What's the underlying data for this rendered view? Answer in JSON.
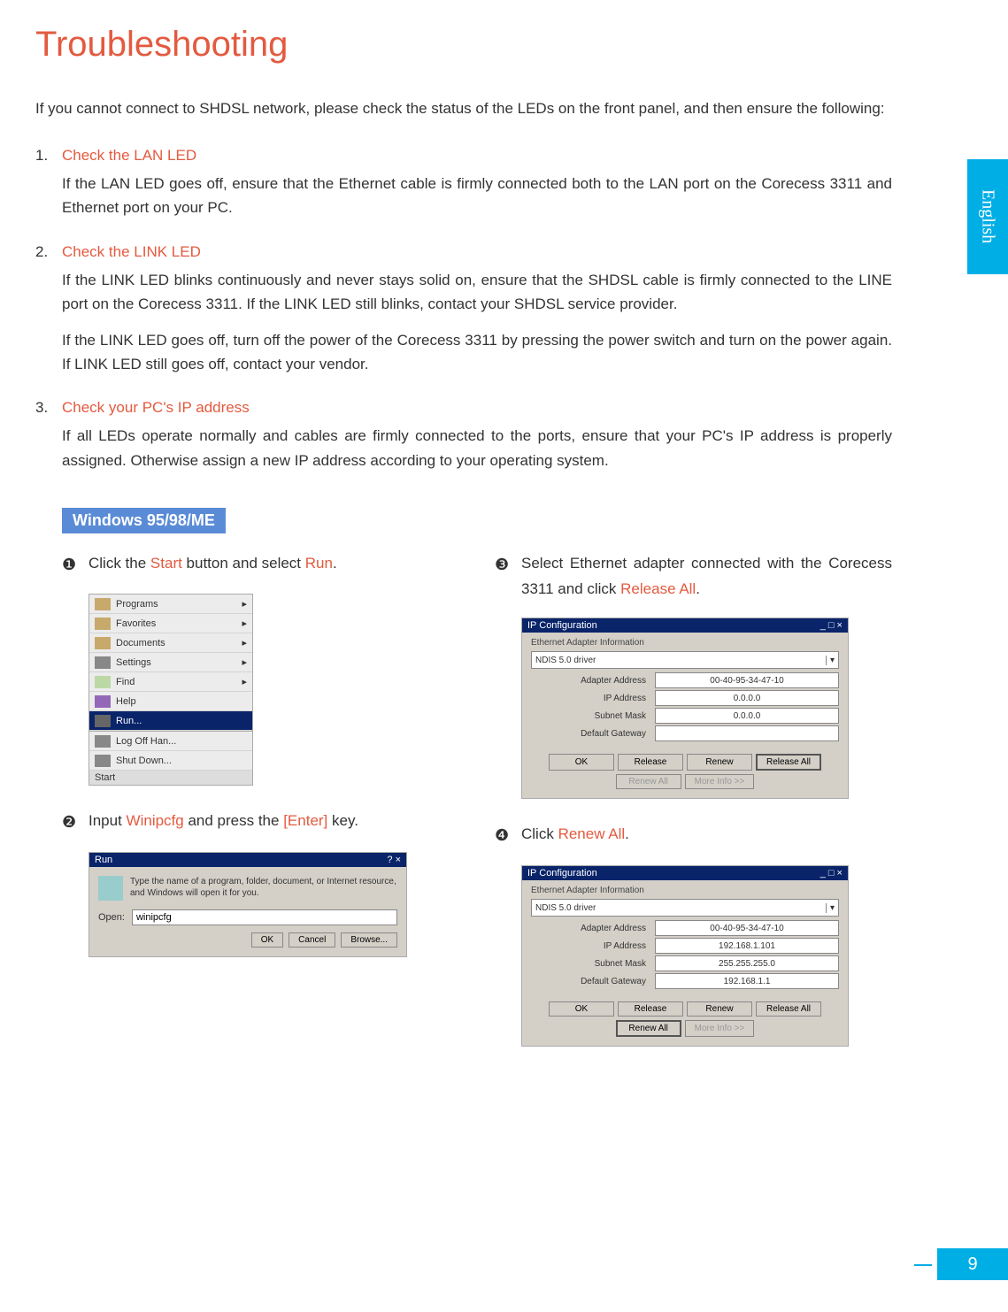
{
  "page": {
    "title": "Troubleshooting",
    "intro": "If you cannot connect to SHDSL network, please check the status of the LEDs on the front panel, and then ensure the following:",
    "side_tab": "English",
    "page_number": "9"
  },
  "steps": [
    {
      "title": "Check the LAN LED",
      "paras": [
        "If the LAN LED goes off, ensure that the Ethernet cable is firmly connected both to the LAN port on the Corecess 3311 and Ethernet port on your PC."
      ]
    },
    {
      "title": "Check the LINK LED",
      "paras": [
        "If the LINK LED blinks continuously and never stays solid on, ensure that the SHDSL cable is firmly connected to the LINE port on the Corecess 3311. If the LINK LED still blinks, contact your SHDSL service provider.",
        "If the LINK LED goes off, turn off the power of the Corecess 3311 by pressing the power switch and turn on the power again. If LINK LED still goes off, contact your vendor."
      ]
    },
    {
      "title": "Check your PC's IP address",
      "paras": [
        "If all LEDs operate normally and cables are firmly connected to the ports, ensure that your PC's IP address is properly assigned. Otherwise assign a new IP address according to your operating system."
      ]
    }
  ],
  "os_tag": "Windows 95/98/ME",
  "sub": {
    "b1": {
      "bullet": "❶",
      "pre": "Click the ",
      "orange1": "Start",
      "mid": " button and select ",
      "orange2": "Run",
      "post": "."
    },
    "b2": {
      "bullet": "❷",
      "pre": "Input ",
      "orange1": "Winipcfg",
      "mid": " and press the ",
      "orange2": "[Enter]",
      "post": " key."
    },
    "b3": {
      "bullet": "❸",
      "pre": "Select Ethernet adapter connected with the Corecess 3311 and click ",
      "orange1": "Release All",
      "post": "."
    },
    "b4": {
      "bullet": "❹",
      "pre": "Click ",
      "orange1": "Renew All",
      "post": "."
    }
  },
  "startmenu": {
    "items": [
      "Programs",
      "Favorites",
      "Documents",
      "Settings",
      "Find",
      "Help",
      "Run..."
    ],
    "lower": [
      "Log Off Han...",
      "Shut Down..."
    ],
    "start": "Start"
  },
  "rundlg": {
    "title": "Run",
    "msg": "Type the name of a program, folder, document, or Internet resource, and Windows will open it for you.",
    "open_label": "Open:",
    "open_value": "winipcfg",
    "btn_ok": "OK",
    "btn_cancel": "Cancel",
    "btn_browse": "Browse..."
  },
  "ipcfg1": {
    "title": "IP Configuration",
    "group": "Ethernet Adapter Information",
    "combo": "NDIS 5.0 driver",
    "fields": {
      "adapter_lbl": "Adapter Address",
      "adapter_val": "00-40-95-34-47-10",
      "ip_lbl": "IP Address",
      "ip_val": "0.0.0.0",
      "mask_lbl": "Subnet Mask",
      "mask_val": "0.0.0.0",
      "gw_lbl": "Default Gateway",
      "gw_val": ""
    },
    "btns": {
      "ok": "OK",
      "release": "Release",
      "renew": "Renew",
      "release_all": "Release All",
      "renew_all": "Renew All",
      "more": "More Info >>"
    }
  },
  "ipcfg2": {
    "title": "IP Configuration",
    "group": "Ethernet Adapter Information",
    "combo": "NDIS 5.0 driver",
    "fields": {
      "adapter_lbl": "Adapter Address",
      "adapter_val": "00-40-95-34-47-10",
      "ip_lbl": "IP Address",
      "ip_val": "192.168.1.101",
      "mask_lbl": "Subnet Mask",
      "mask_val": "255.255.255.0",
      "gw_lbl": "Default Gateway",
      "gw_val": "192.168.1.1"
    },
    "btns": {
      "ok": "OK",
      "release": "Release",
      "renew": "Renew",
      "release_all": "Release All",
      "renew_all": "Renew All",
      "more": "More Info >>"
    }
  }
}
